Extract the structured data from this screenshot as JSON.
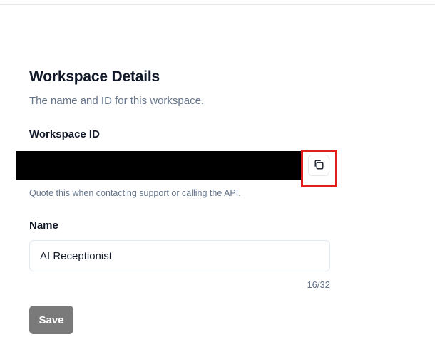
{
  "section": {
    "title": "Workspace Details",
    "subtitle": "The name and ID for this workspace."
  },
  "workspace_id": {
    "label": "Workspace ID",
    "value_redacted": true,
    "copy_icon": "copy-icon",
    "hint": "Quote this when contacting support or calling the API."
  },
  "name": {
    "label": "Name",
    "value": "AI Receptionist",
    "char_count": "16/32"
  },
  "actions": {
    "save_label": "Save"
  },
  "colors": {
    "highlight": "#e11d1d",
    "save_button_bg": "#7a7a7a",
    "muted_text": "#64748b"
  }
}
